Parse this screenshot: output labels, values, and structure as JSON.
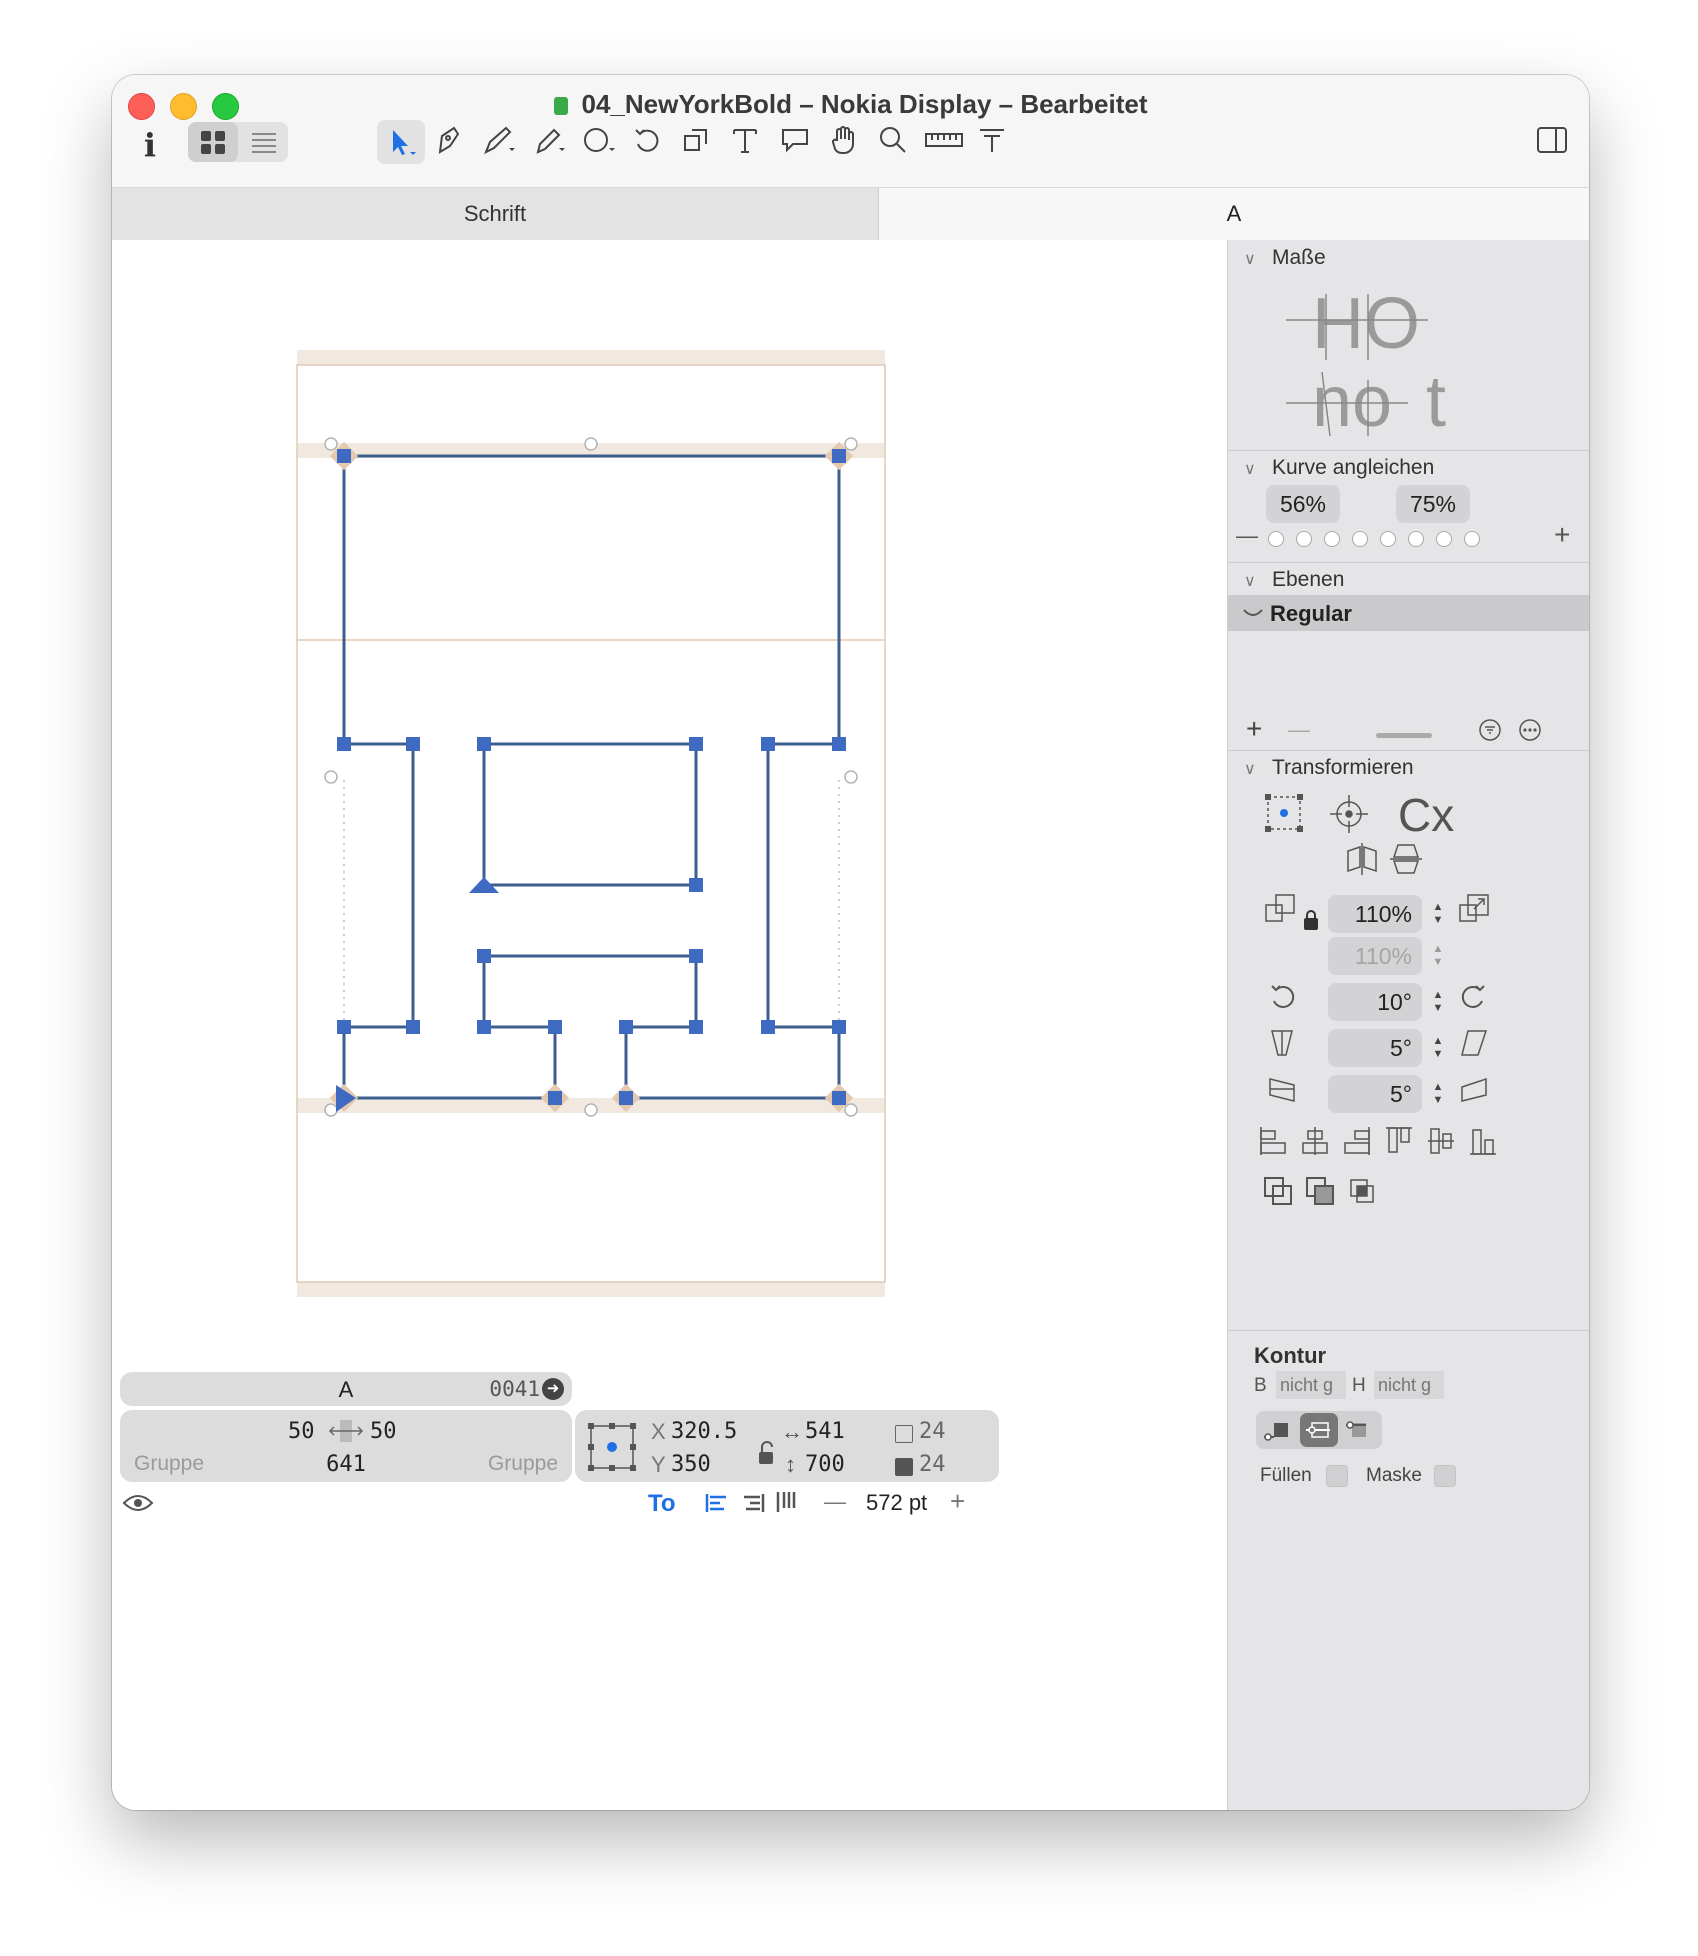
{
  "window": {
    "title": "04_NewYorkBold – Nokia Display – Bearbeitet"
  },
  "toolbar": {
    "tools": [
      "info-icon",
      "grid-view-icon",
      "list-view-icon",
      "select-tool-icon",
      "pen-tool-icon",
      "brush-tool-icon",
      "pencil-tool-icon",
      "shape-tool-icon",
      "rotate-tool-icon",
      "scale-tool-icon",
      "text-tool-icon",
      "annotation-tool-icon",
      "hand-tool-icon",
      "zoom-tool-icon",
      "measure-tool-icon",
      "text-metrics-tool-icon",
      "sidebar-toggle-icon"
    ]
  },
  "tabs": {
    "font_tab": "Schrift",
    "glyph_tab": "A"
  },
  "sidebar": {
    "metrics": {
      "title": "Maße",
      "sample1": "HO",
      "sample2": "no",
      "sample3": "t"
    },
    "curves": {
      "title": "Kurve angleichen",
      "value1": "56%",
      "value2": "75%",
      "minus": "—",
      "plus": "+"
    },
    "layers": {
      "title": "Ebenen",
      "active_layer": "Regular",
      "add": "+",
      "remove": "—"
    },
    "transform": {
      "title": "Transformieren",
      "sample": "Cx",
      "scale_x": "110%",
      "scale_y": "110%",
      "rotate": "10°",
      "slant": "5°",
      "skew": "5°"
    },
    "kontur": {
      "title": "Kontur",
      "b_label": "B",
      "b_placeholder": "nicht g",
      "h_label": "H",
      "h_placeholder": "nicht g",
      "fill_label": "Füllen",
      "mask_label": "Maske"
    }
  },
  "glyph_info": {
    "name": "A",
    "unicode": "0041",
    "lsb": "50",
    "rsb": "50",
    "width": "641",
    "left_group": "Gruppe",
    "right_group": "Gruppe"
  },
  "selection_info": {
    "x_label": "X",
    "x": "320.5",
    "y_label": "Y",
    "y": "350",
    "w": "541",
    "h": "700",
    "nodes_open": "24",
    "nodes_filled": "24"
  },
  "statusbar": {
    "zoom": "572 pt",
    "minus": "—",
    "plus": "+"
  },
  "colors": {
    "node": "#3e6ac2",
    "path": "#3d5f8f",
    "metric_band": "#f1e8df",
    "metric_line": "#e3c9b0",
    "red": "#fe5f57",
    "yellow": "#febc2e",
    "green": "#28c840"
  }
}
